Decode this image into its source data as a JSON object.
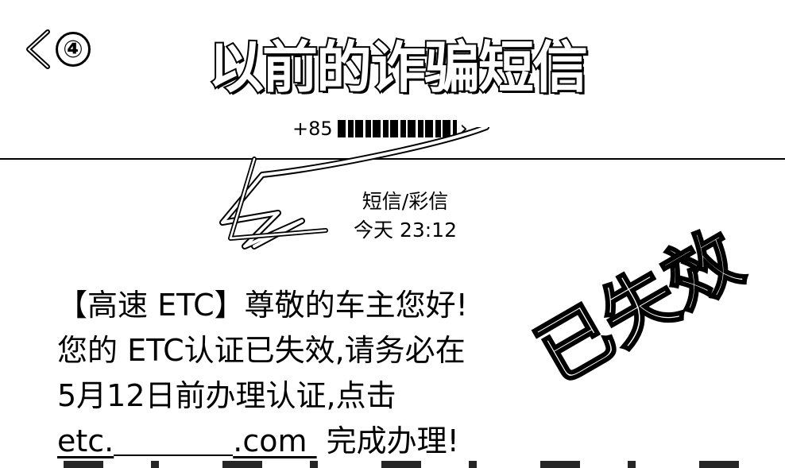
{
  "header": {
    "back_icon": "chevron-left-icon",
    "badge": "④",
    "title": "以前的诈骗短信",
    "contact_prefix": "+85",
    "contact_chevron": "›"
  },
  "message_meta": {
    "type": "短信/彩信",
    "time": "今天 23:12"
  },
  "message": {
    "line1": "【高速 ETC】尊敬的车主您好!",
    "line2": "您的 ETC认证已失效,请务必在",
    "line3": "5月12日前办理认证,点击",
    "link_start": "etc.",
    "link_end": ".com",
    "line4_tail": " 完成办理!"
  },
  "annotation": {
    "stamp": "已失效"
  }
}
